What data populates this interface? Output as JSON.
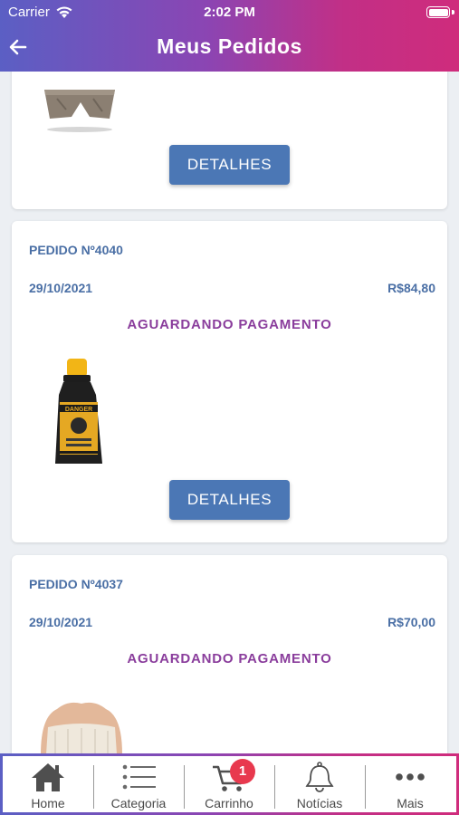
{
  "status_bar": {
    "carrier": "Carrier",
    "time": "2:02 PM"
  },
  "header": {
    "title": "Meus Pedidos"
  },
  "orders_actions": {
    "details_label": "DETALHES"
  },
  "orders": [
    {
      "number": "PEDIDO Nº4040",
      "date": "29/10/2021",
      "total": "R$84,80",
      "status": "AGUARDANDO PAGAMENTO",
      "product_label": "DANGER"
    },
    {
      "number": "PEDIDO Nº4037",
      "date": "29/10/2021",
      "total": "R$70,00",
      "status": "AGUARDANDO PAGAMENTO"
    }
  ],
  "tab_bar": {
    "items": [
      {
        "label": "Home",
        "icon": "home-icon"
      },
      {
        "label": "Categoria",
        "icon": "list-icon"
      },
      {
        "label": "Carrinho",
        "icon": "cart-icon",
        "badge": "1"
      },
      {
        "label": "Notícias",
        "icon": "bell-icon"
      },
      {
        "label": "Mais",
        "icon": "more-icon"
      }
    ]
  },
  "colors": {
    "accent": "#4b77b5",
    "status": "#8a3d9c",
    "badge": "#e8394e",
    "header_start": "#5b5fc4",
    "header_end": "#cf2c7c"
  }
}
